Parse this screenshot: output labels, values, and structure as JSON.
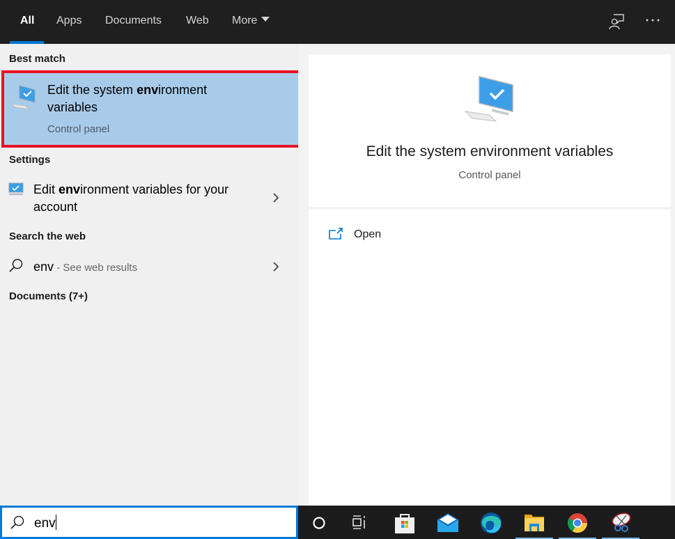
{
  "nav": {
    "tabs": [
      {
        "label": "All",
        "active": true
      },
      {
        "label": "Apps"
      },
      {
        "label": "Documents"
      },
      {
        "label": "Web"
      },
      {
        "label": "More"
      }
    ],
    "icons": [
      "feedback-icon",
      "more-options-icon"
    ]
  },
  "left": {
    "best_match_heading": "Best match",
    "best_match": {
      "title_pre": "Edit the system ",
      "title_highlight": "env",
      "title_post": "ironment variables",
      "subtitle": "Control panel",
      "icon": "computer-check-icon",
      "highlight_color": "#e81123"
    },
    "settings_heading": "Settings",
    "settings_item": {
      "pre": "Edit ",
      "highlight": "env",
      "post": "ironment variables for your account",
      "icon": "monitor-settings-icon"
    },
    "web_heading": "Search the web",
    "web_item": {
      "query": "env",
      "suffix": " - See web results",
      "icon": "search-icon"
    },
    "documents_heading": "Documents (7+)"
  },
  "right": {
    "title": "Edit the system environment variables",
    "subtitle": "Control panel",
    "actions": [
      {
        "label": "Open",
        "icon": "open-external-icon"
      }
    ]
  },
  "search": {
    "value": "env",
    "icon": "search-icon"
  },
  "taskbar": {
    "items": [
      {
        "name": "cortana",
        "icon": "cortana-circle-icon",
        "running": false
      },
      {
        "name": "task-view",
        "icon": "task-view-icon",
        "running": false
      },
      {
        "name": "microsoft-store",
        "icon": "store-bag-icon",
        "running": false
      },
      {
        "name": "mail",
        "icon": "mail-envelope-icon",
        "running": false
      },
      {
        "name": "edge",
        "icon": "edge-icon",
        "running": false
      },
      {
        "name": "file-explorer",
        "icon": "folder-icon",
        "running": true
      },
      {
        "name": "chrome",
        "icon": "chrome-icon",
        "running": true
      },
      {
        "name": "snipping-tool",
        "icon": "scissors-icon",
        "running": true
      }
    ]
  },
  "colors": {
    "accent": "#0078d7",
    "selection": "#a9cbea",
    "annotation_red": "#e81123",
    "topbar": "#1f1f1f",
    "taskbar": "#1c1c1c"
  }
}
